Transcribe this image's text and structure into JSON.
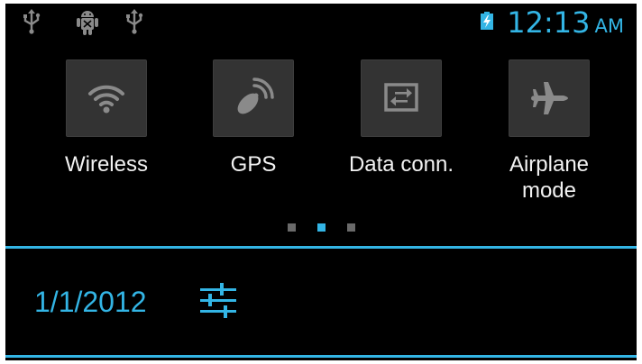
{
  "status_bar": {
    "icons": [
      "usb-icon",
      "android-debug-icon",
      "usb-icon"
    ],
    "battery_icon": "battery-charging-icon",
    "clock_time": "12:13",
    "clock_ampm": "AM"
  },
  "quick_settings": {
    "tiles": [
      {
        "label": "Wireless",
        "icon": "wifi-icon"
      },
      {
        "label": "GPS",
        "icon": "gps-icon"
      },
      {
        "label": "Data conn.",
        "icon": "data-connection-icon"
      },
      {
        "label": "Airplane mode",
        "label_line1": "Airplane",
        "label_line2": "mode",
        "icon": "airplane-icon"
      }
    ],
    "pager": {
      "count": 3,
      "active_index": 1
    }
  },
  "notification_header": {
    "date": "1/1/2012",
    "settings_icon": "settings-sliders-icon"
  },
  "colors": {
    "accent": "#33b5e5",
    "background": "#000000",
    "tile_background": "#333333",
    "label_text": "#f2f2f2",
    "icon_grey": "#8a8a8a"
  }
}
